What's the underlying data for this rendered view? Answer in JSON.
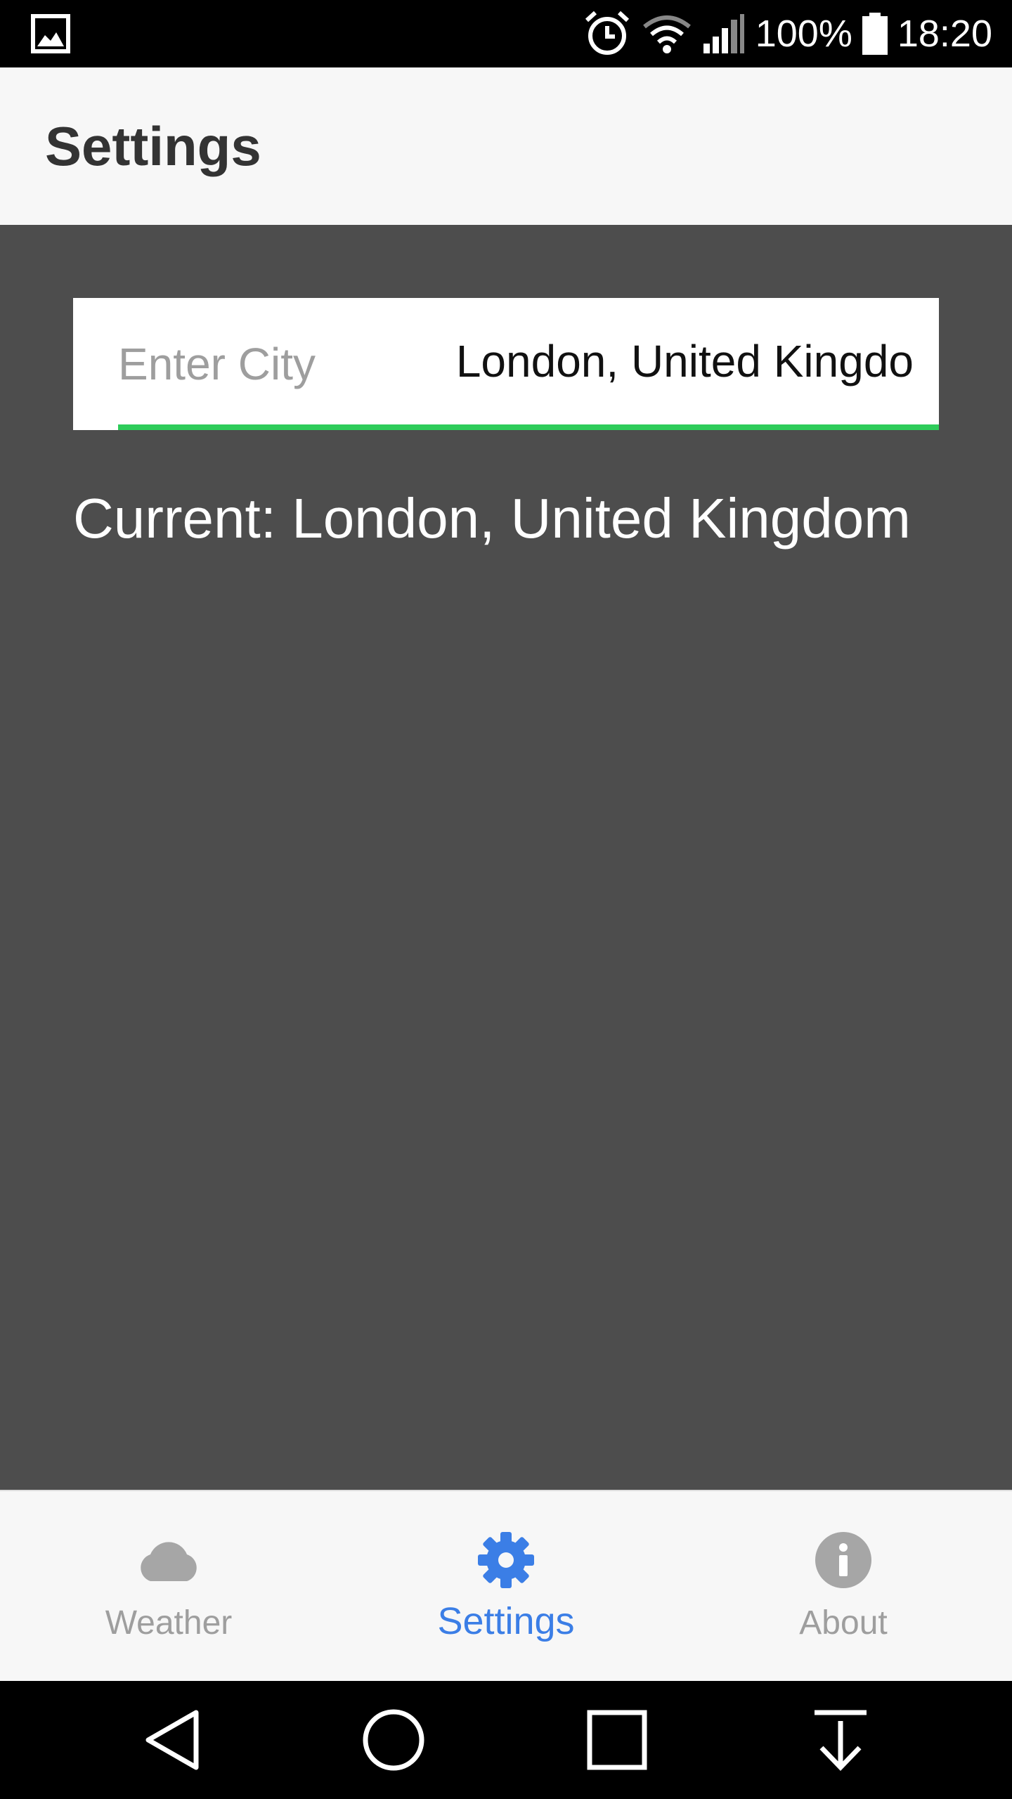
{
  "status_bar": {
    "icons": [
      "gallery-icon",
      "alarm-icon",
      "wifi-icon",
      "signal-icon",
      "battery-icon"
    ],
    "battery": "100%",
    "time": "18:20"
  },
  "app_bar": {
    "title": "Settings"
  },
  "city_form": {
    "label": "Enter City",
    "value": "London, United Kingdo",
    "underline_color": "#2ecc5a"
  },
  "current_city": "Current: London, United Kingdom",
  "bottom_nav": {
    "items": [
      {
        "label": "Weather",
        "icon": "cloud-icon",
        "active": false
      },
      {
        "label": "Settings",
        "icon": "gear-icon",
        "active": true
      },
      {
        "label": "About",
        "icon": "info-icon",
        "active": false
      }
    ],
    "active_color": "#3b7ee6",
    "inactive_color": "#9e9e9e"
  },
  "system_nav": {
    "buttons": [
      "back-icon",
      "home-icon",
      "recents-icon",
      "notification-pull-icon"
    ]
  }
}
